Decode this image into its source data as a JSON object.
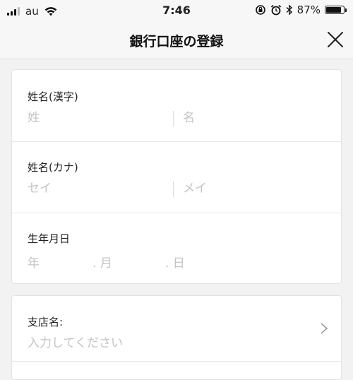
{
  "status_bar": {
    "carrier": "au",
    "time": "7:46",
    "battery_percent": "87%",
    "battery_level": 0.87,
    "icons": [
      "signal-icon",
      "wifi-icon",
      "orientation-lock-icon",
      "alarm-icon",
      "bluetooth-icon",
      "battery-icon"
    ]
  },
  "nav": {
    "title": "銀行口座の登録",
    "close_icon": "close-icon"
  },
  "form": {
    "name_kanji": {
      "label": "姓名(漢字)",
      "last_placeholder": "姓",
      "first_placeholder": "名"
    },
    "name_kana": {
      "label": "姓名(カナ)",
      "last_placeholder": "セイ",
      "first_placeholder": "メイ"
    },
    "birthdate": {
      "label": "生年月日",
      "year": "年",
      "month": ". 月",
      "day": ". 日"
    },
    "branch": {
      "label": "支店名:",
      "placeholder": "入力してください",
      "chevron_icon": "chevron-right-icon"
    }
  }
}
